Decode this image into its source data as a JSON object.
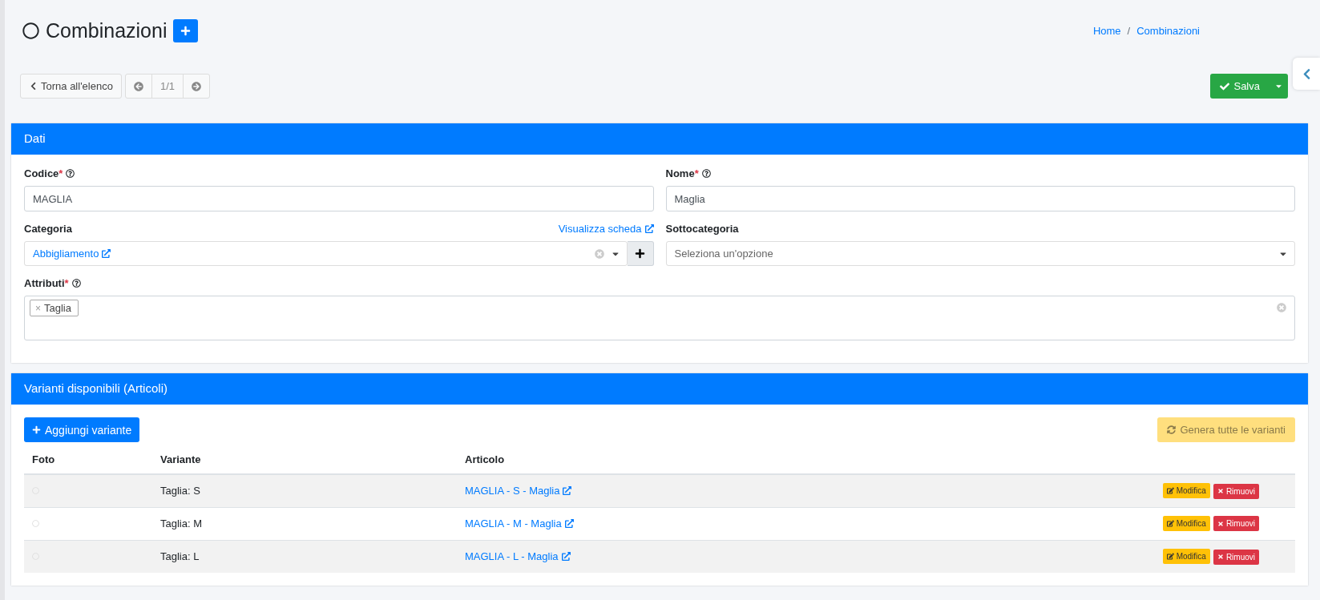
{
  "header": {
    "title": "Combinazioni",
    "breadcrumb": [
      "Home",
      "Combinazioni"
    ],
    "breadcrumb_separator": "/"
  },
  "toolbar": {
    "back": "Torna all'elenco",
    "pager": "1/1",
    "save": "Salva"
  },
  "dati": {
    "title": "Dati",
    "codice": {
      "label": "Codice",
      "required_mark": "*",
      "value": "MAGLIA"
    },
    "nome": {
      "label": "Nome",
      "required_mark": "*",
      "value": "Maglia"
    },
    "categoria": {
      "label": "Categoria",
      "link": "Visualizza scheda",
      "value": "Abbigliamento"
    },
    "sottocategoria": {
      "label": "Sottocategoria",
      "placeholder": "Seleziona un'opzione"
    },
    "attributi": {
      "label": "Attributi",
      "required_mark": "*",
      "tags": [
        {
          "label": "Taglia",
          "remove": "×"
        }
      ]
    }
  },
  "varianti": {
    "title": "Varianti disponibili (Articoli)",
    "add": "Aggiungi variante",
    "generate": "Genera tutte le varianti",
    "columns": [
      "Foto",
      "Variante",
      "Articolo"
    ],
    "rows": [
      {
        "variante": "Taglia: S",
        "articolo": "MAGLIA - S - Maglia",
        "edit": "Modifica",
        "remove": "Rimuovi"
      },
      {
        "variante": "Taglia: M",
        "articolo": "MAGLIA - M - Maglia",
        "edit": "Modifica",
        "remove": "Rimuovi"
      },
      {
        "variante": "Taglia: L",
        "articolo": "MAGLIA - L - Maglia",
        "edit": "Modifica",
        "remove": "Rimuovi"
      }
    ]
  }
}
